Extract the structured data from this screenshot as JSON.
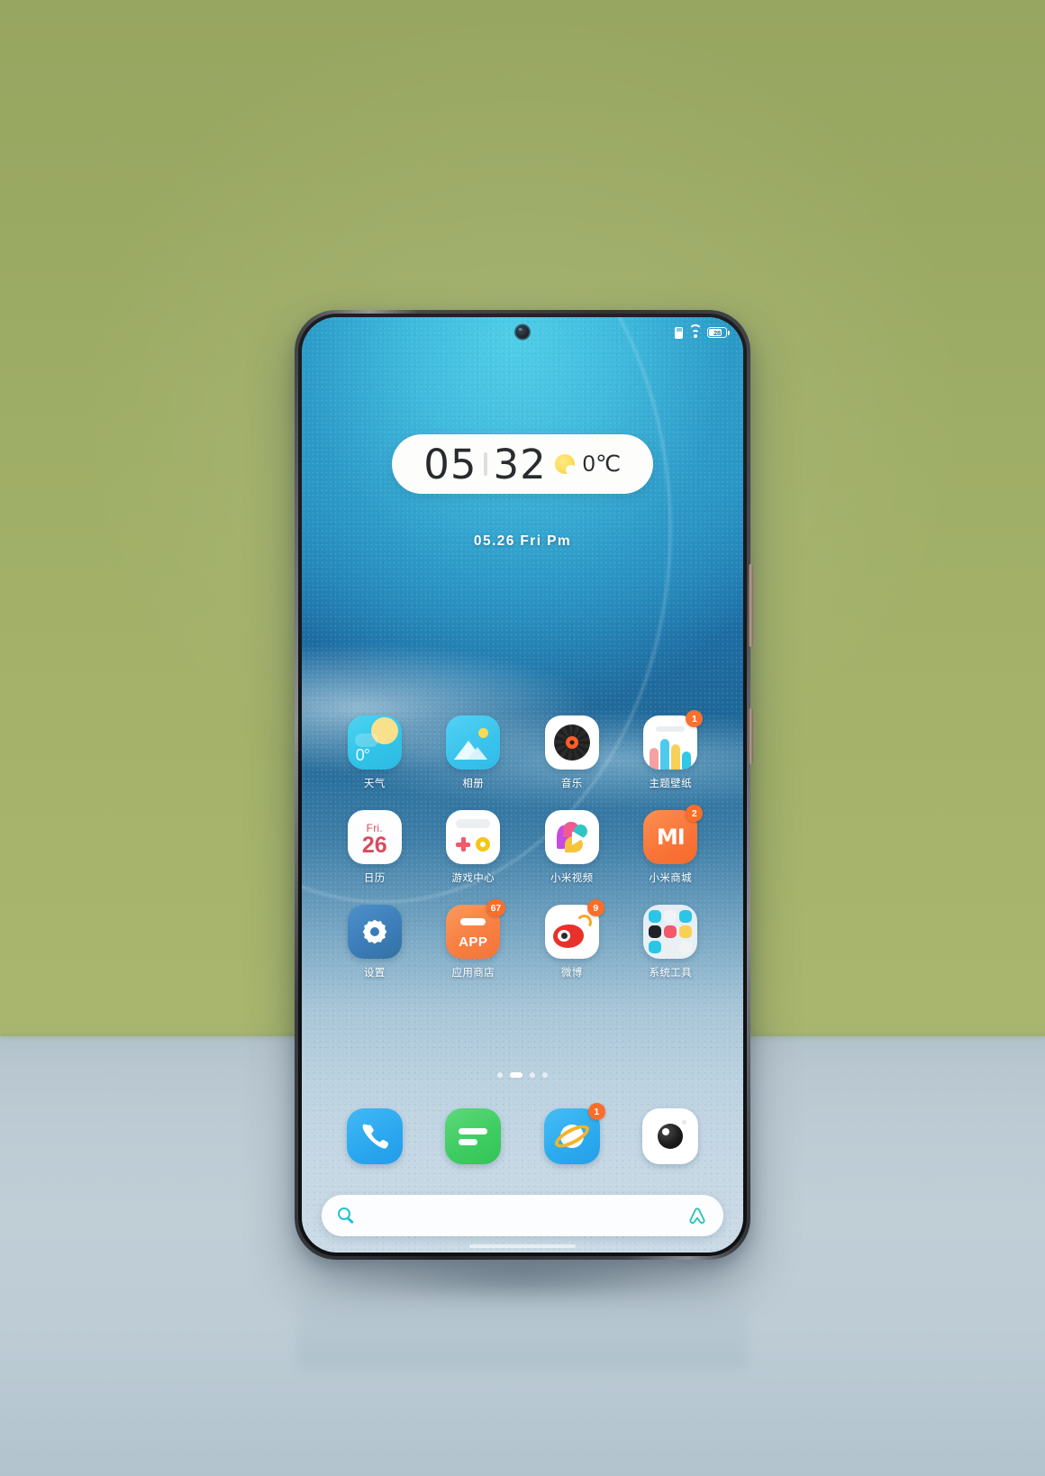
{
  "scene": {
    "background_top_color": "#a3b169",
    "surface_color": "#bdccd4",
    "description": "Smartphone standing on a light blue-grey surface against an olive green backdrop"
  },
  "phone": {
    "frame_color": "#2e2f33",
    "power_button": "power-button",
    "volume_button": "volume-button"
  },
  "status_bar": {
    "sim_icon": "sim-card-icon",
    "wifi_icon": "wifi-icon",
    "battery_icon": "battery-icon",
    "battery_percent": "28"
  },
  "clock_widget": {
    "hours": "05",
    "minutes": "32",
    "weather_icon": "sun-icon",
    "temperature": "0℃",
    "date": "05.26 Fri Pm"
  },
  "home_screen": {
    "rows": [
      {
        "apps": [
          {
            "label": "天气",
            "icon": "weather-icon",
            "badge": null
          },
          {
            "label": "相册",
            "icon": "gallery-icon",
            "badge": null
          },
          {
            "label": "音乐",
            "icon": "music-icon",
            "badge": null
          },
          {
            "label": "主题壁纸",
            "icon": "themes-icon",
            "badge": "1"
          }
        ]
      },
      {
        "apps": [
          {
            "label": "日历",
            "icon": "calendar-icon",
            "badge": null,
            "weekday": "Fri.",
            "day": "26"
          },
          {
            "label": "游戏中心",
            "icon": "game-center-icon",
            "badge": null
          },
          {
            "label": "小米视频",
            "icon": "mi-video-icon",
            "badge": null
          },
          {
            "label": "小米商城",
            "icon": "mi-store-icon",
            "badge": "2",
            "logo_text": "MI"
          }
        ]
      },
      {
        "apps": [
          {
            "label": "设置",
            "icon": "settings-gear-icon",
            "badge": null
          },
          {
            "label": "应用商店",
            "icon": "app-store-icon",
            "badge": "67",
            "logo_text": "APP"
          },
          {
            "label": "微博",
            "icon": "weibo-icon",
            "badge": "9"
          },
          {
            "label": "系统工具",
            "icon": "system-tools-folder-icon",
            "badge": null
          }
        ]
      }
    ],
    "page_indicator": {
      "total": 4,
      "active_index": 1
    }
  },
  "dock": {
    "apps": [
      {
        "name": "phone",
        "icon": "phone-handset-icon",
        "badge": null
      },
      {
        "name": "messages",
        "icon": "messages-icon",
        "badge": null
      },
      {
        "name": "browser",
        "icon": "browser-planet-icon",
        "badge": "1"
      },
      {
        "name": "camera",
        "icon": "camera-lens-icon",
        "badge": null
      }
    ]
  },
  "search_bar": {
    "search_icon": "search-icon",
    "assistant_icon": "assistant-logo-icon",
    "placeholder": ""
  },
  "colors": {
    "badge": "#fa6e2a",
    "accent_cyan": "#2fc3e8",
    "mi_orange": "#f97437",
    "weibo_red": "#e8312a",
    "settings_blue": "#3b7cb8"
  }
}
